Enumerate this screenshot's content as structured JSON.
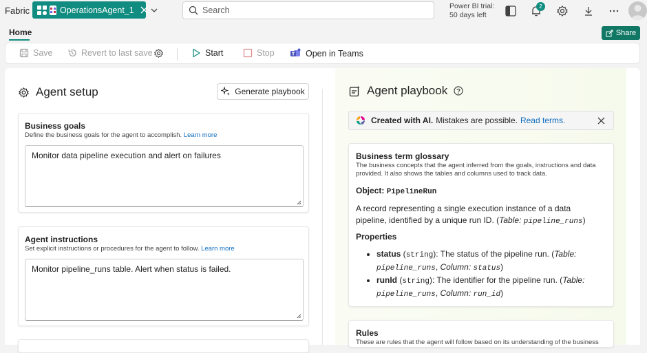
{
  "app": {
    "brand": "Fabric"
  },
  "item_tab": {
    "label": "OperationsAgent_1"
  },
  "search": {
    "placeholder": "Search"
  },
  "trial": {
    "line1": "Power BI trial:",
    "line2": "50 days left"
  },
  "notifications": {
    "count": "2"
  },
  "ribbon": {
    "home_tab": "Home",
    "share_label": "Share"
  },
  "toolbar": {
    "save": "Save",
    "revert": "Revert to last save",
    "start": "Start",
    "stop": "Stop",
    "open_teams": "Open in Teams"
  },
  "agent_setup": {
    "title": "Agent setup",
    "generate_button": "Generate playbook",
    "business_goals": {
      "title": "Business goals",
      "desc": "Define the business goals for the agent to accomplish.",
      "link": "Learn more",
      "value": "Monitor data pipeline execution and alert on failures"
    },
    "agent_instructions": {
      "title": "Agent instructions",
      "desc": "Set explicit instructions or procedures for the agent to follow.",
      "link": "Learn more",
      "value": "Monitor pipeline_runs table. Alert when status is failed."
    }
  },
  "playbook": {
    "title": "Agent playbook",
    "banner": {
      "strong": "Created with AI.",
      "rest": "Mistakes are possible.",
      "link": "Read terms."
    },
    "glossary": {
      "title": "Business term glossary",
      "desc": "The business concepts that the agent inferred from the goals, instructions and data provided. It also shows the tables and columns used to track data.",
      "object_label": "Object:",
      "object_name": "PipelineRun",
      "object_desc": "A record representing a single execution instance of a data pipeline, identified by a unique run ID.",
      "object_table_label": "Table:",
      "object_table": "pipeline_runs",
      "properties_label": "Properties",
      "properties": [
        {
          "name": "status",
          "type": "string",
          "desc": ": The status of the pipeline run.",
          "table_label": "Table:",
          "table": "pipeline_runs",
          "column_label": "Column:",
          "column": "status"
        },
        {
          "name": "runId",
          "type": "string",
          "desc": ": The identifier for the pipeline run.",
          "table_label": "Table:",
          "table": "pipeline_runs",
          "column_label": "Column:",
          "column": "run_id"
        }
      ]
    },
    "rules": {
      "title": "Rules",
      "desc": "These are rules that the agent will follow based on its understanding of the business"
    }
  },
  "colors": {
    "accent": "#108c80",
    "share": "#117865",
    "link": "#0f6cbd"
  },
  "icons": [
    "item-icon",
    "chevron-down-icon",
    "search-icon",
    "panel-icon",
    "bell-icon",
    "gear-icon",
    "download-icon",
    "more-icon",
    "save-icon",
    "revert-icon",
    "play-icon",
    "stop-icon",
    "teams-icon",
    "sparkle-icon",
    "help-icon",
    "copilot-icon",
    "close-icon"
  ]
}
